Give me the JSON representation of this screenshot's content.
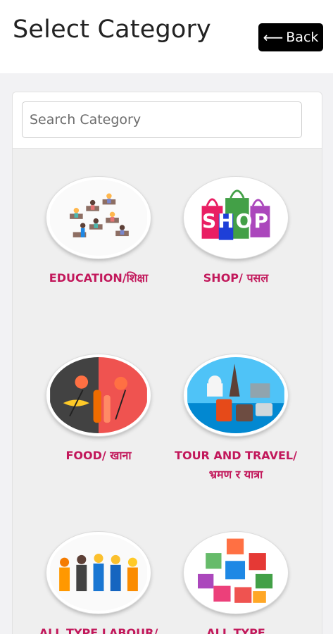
{
  "header": {
    "title": "Select Category",
    "back_label": "Back"
  },
  "search": {
    "placeholder": "Search Category"
  },
  "categories": [
    {
      "label": "EDUCATION/शिक्षा"
    },
    {
      "label": "SHOP/ पसल",
      "art_text": [
        "S",
        "H",
        "O",
        "P"
      ]
    },
    {
      "label": "FOOD/ खाना"
    },
    {
      "label": "TOUR AND TRAVEL/भ्रमण र यात्रा"
    },
    {
      "label": "ALL TYPE LABOUR/सबै"
    },
    {
      "label": "ALL TYPE"
    }
  ],
  "colors": {
    "label": "#c2185b",
    "back_button": "#000000",
    "card_bg": "#efefef"
  }
}
